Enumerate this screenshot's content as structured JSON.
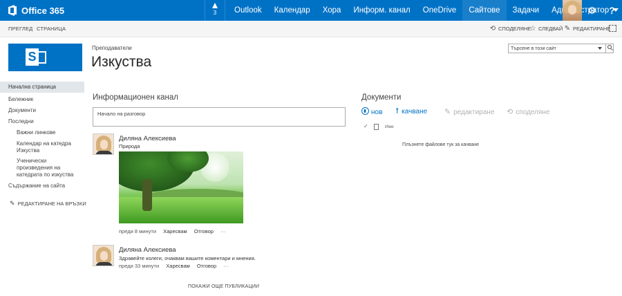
{
  "suite_bar": {
    "brand": "Office 365",
    "notifications_count": "3",
    "nav": [
      "Outlook",
      "Календар",
      "Хора",
      "Информ. канал",
      "OneDrive",
      "Сайтове",
      "Задачи",
      "Администратор"
    ],
    "active_nav": "Сайтове",
    "colors": {
      "bar": "#0072c6",
      "active": "#1a7fcb"
    },
    "icons": [
      "bell-icon",
      "gear-icon",
      "help-icon"
    ]
  },
  "ribbon": {
    "tabs": [
      "ПРЕГЛЕД",
      "СТРАНИЦА"
    ],
    "actions": [
      "СПОДЕЛЯНЕ",
      "СЛЕДВАЙ",
      "РЕДАКТИРАНЕ"
    ]
  },
  "site": {
    "breadcrumb": "Преподаватели",
    "title": "Изкуства",
    "search_placeholder": "Търсене в този сайт"
  },
  "quicklaunch": {
    "items": [
      "Начална страница",
      "Бележник",
      "Документи",
      "Последни"
    ],
    "recent": [
      "Важни линкове",
      "Календар на катедра Изкуства",
      "Ученически произведения на катедрата по изкуства"
    ],
    "site_contents": "Съдържание на сайта",
    "edit_links": "РЕДАКТИРАНЕ НА ВРЪЗКИ"
  },
  "newsfeed": {
    "title": "Информационен канал",
    "placeholder": "Начало на разговор",
    "posts": [
      {
        "author": "Диляна Алексиева",
        "text": "Природа",
        "time": "преди 8 минути",
        "like": "Харесвам",
        "reply": "Отговор",
        "more": "···"
      },
      {
        "author": "Диляна Алексиева",
        "text": "Здравейте колеги, очаквам вашите коментари и мнения.",
        "time": "преди 33 минути",
        "like": "Харесвам",
        "reply": "Отговор",
        "more": "···"
      }
    ],
    "show_more": "ПОКАЖИ ОЩЕ ПУБЛИКАЦИИ"
  },
  "documents": {
    "title": "Документи",
    "commands": [
      "нов",
      "качване",
      "редактиране",
      "споделяне"
    ],
    "column_name": "Име",
    "drop_hint": "Плъзнете файлове тук за качване"
  }
}
